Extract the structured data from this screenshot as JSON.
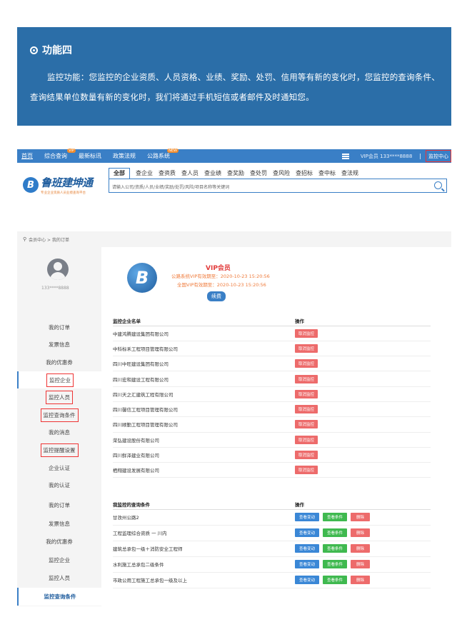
{
  "banner": {
    "title": "功能四",
    "text": "监控功能：您监控的企业资质、人员资格、业绩、奖励、处罚、信用等有新的变化时，您监控的查询条件、查询结果单位数量有新的变化时，我们将通过手机短信或者邮件及时通知您。"
  },
  "navbar": {
    "items": [
      "首页",
      "综合查询",
      "最新标讯",
      "政策法规",
      "公路系统"
    ],
    "badge_vip": "VIP",
    "badge_new": "NEW",
    "vip_user": "VIP会员 133****8888",
    "separator": "|",
    "monitor_center": "监控中心"
  },
  "logo": {
    "name": "鲁班建坤通",
    "slogan": "专业企业资质人员业绩查询平台"
  },
  "search": {
    "tabs": [
      "全部",
      "查企业",
      "查资质",
      "查人员",
      "查业绩",
      "查奖励",
      "查处罚",
      "查风险",
      "查招标",
      "查中标",
      "查法规"
    ],
    "placeholder": "请输入公司/资质/人员/业绩/奖励/处罚/风险/项目名称等关键词"
  },
  "breadcrumb": "会员中心 > 我的订单",
  "user": {
    "phone": "133****8888"
  },
  "side_menu": [
    {
      "label": "我的订单",
      "boxed": false
    },
    {
      "label": "发票信息",
      "boxed": false
    },
    {
      "label": "我的优惠券",
      "boxed": false
    },
    {
      "label": "监控企业",
      "boxed": true
    },
    {
      "label": "监控人员",
      "boxed": true
    },
    {
      "label": "监控查询条件",
      "boxed": true
    },
    {
      "label": "我的消息",
      "boxed": false
    },
    {
      "label": "监控提醒设置",
      "boxed": true
    },
    {
      "label": "企业认证",
      "boxed": false
    },
    {
      "label": "我的认证",
      "boxed": false
    }
  ],
  "vip": {
    "title": "VIP会员",
    "line1": "公路系统VIP有效期至：2020-10-23 15:20:56",
    "line2": "全国VIP有效期至：2020-10-23 15:20:56",
    "renew": "续费"
  },
  "monitor_table": {
    "header_name": "监控企业名单",
    "header_op": "操作",
    "action": "取消监控",
    "rows": [
      "中建鸿腾建设集团有限公司",
      "中科标禾工程项目管理有限公司",
      "四川中旺建设集团有限公司",
      "四川宏和建设工程有限公司",
      "四川天之汇建筑工程有限公司",
      "四川馨信工程项目管理有限公司",
      "四川顺勤工程项目管理有限公司",
      "荣弘建设股份有限公司",
      "四川鲜泽建业有限公司",
      "栖翔建设发展有限公司"
    ]
  },
  "side_menu2": [
    "我的订单",
    "发票信息",
    "我的优惠券",
    "监控企业",
    "监控人员",
    "监控查询条件"
  ],
  "condition_table": {
    "header_name": "我监控的查询条件",
    "header_op": "操作",
    "btn_view_change": "查看变动",
    "btn_view_cond": "查看条件",
    "btn_delete": "删除",
    "rows": [
      "甘孜州公路2",
      "工程监理综合资质 一 川内",
      "建筑总承包一级＋消防安全工程师",
      "水利施工总承包二级条件",
      "市政公用工程施工总承包一级及以上"
    ]
  }
}
